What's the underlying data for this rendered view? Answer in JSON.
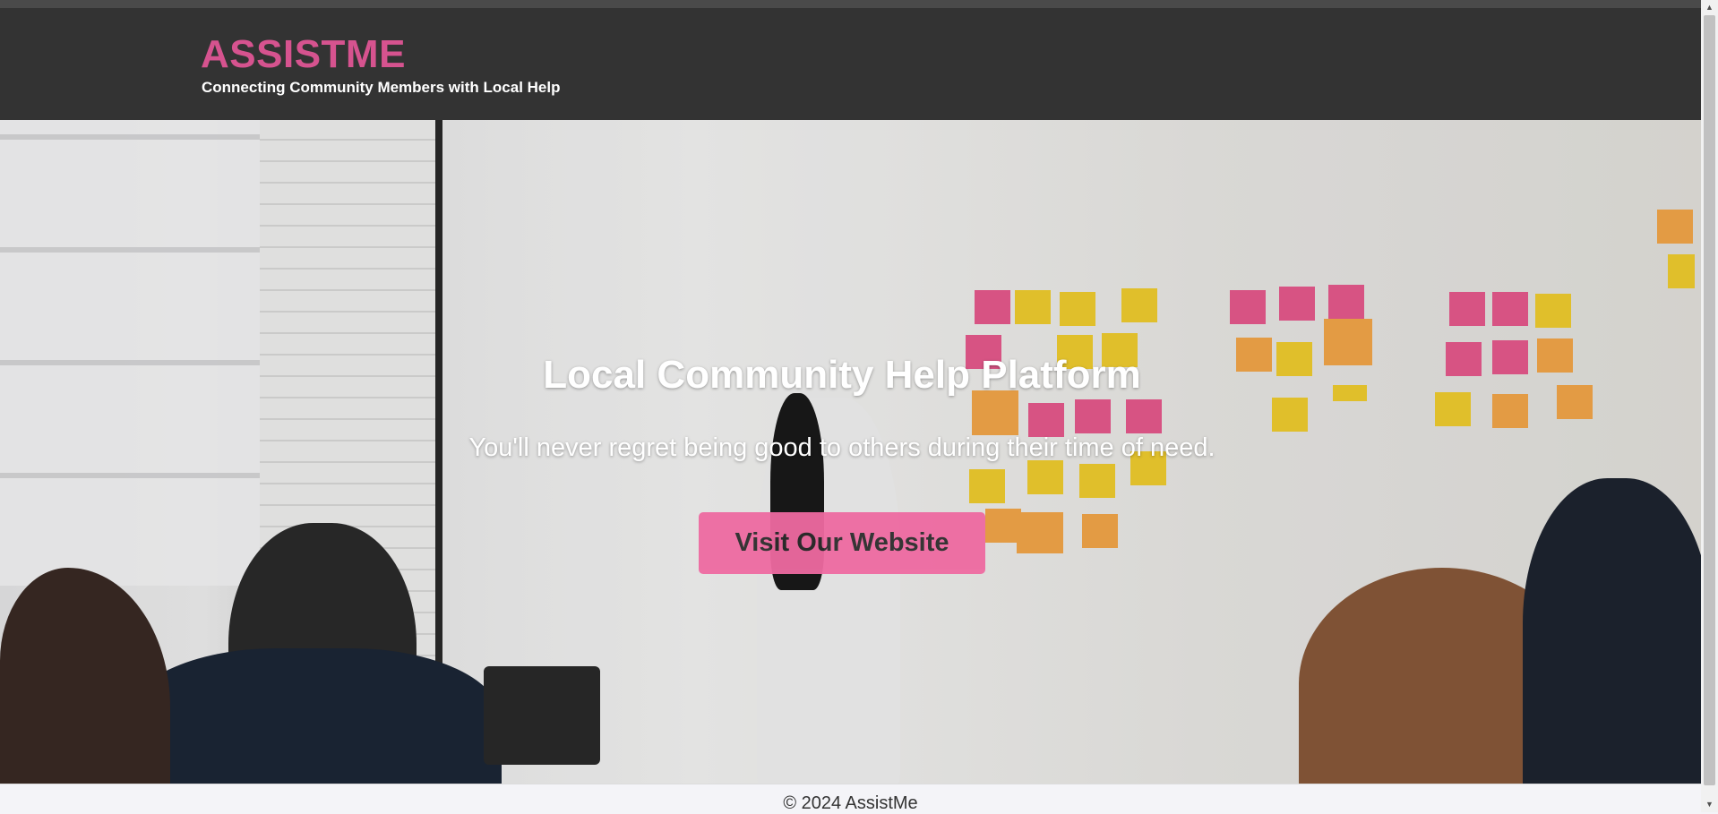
{
  "header": {
    "brand": "ASSISTME",
    "tagline": "Connecting Community Members with Local Help"
  },
  "hero": {
    "title": "Local Community Help Platform",
    "subtitle": "You'll never regret being good to others during their time of need.",
    "cta_label": "Visit Our Website"
  },
  "footer": {
    "copyright": "© 2024 AssistMe"
  },
  "colors": {
    "brand": "#d6538f",
    "header_bg": "#333333",
    "cta_bg": "#ee6aa1"
  },
  "icons": {
    "scroll_up": "triangle-up-icon",
    "scroll_down": "triangle-down-icon"
  }
}
